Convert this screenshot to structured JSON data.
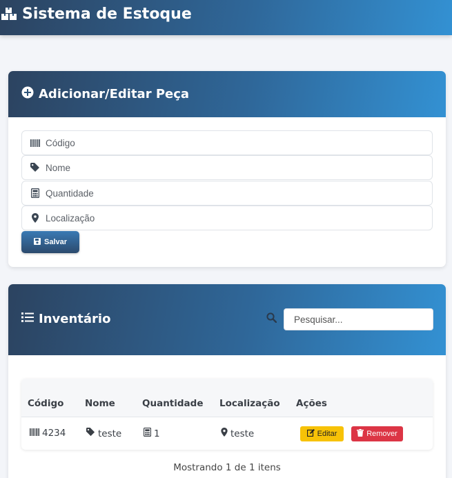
{
  "app": {
    "title": "Sistema de Estoque",
    "icon": "boxes-icon"
  },
  "form": {
    "title": "Adicionar/Editar Peça",
    "icon": "plus-circle-icon",
    "fields": {
      "codigo": {
        "placeholder": "Código",
        "value": "",
        "icon": "barcode-icon"
      },
      "nome": {
        "placeholder": "Nome",
        "value": "",
        "icon": "tag-icon"
      },
      "quantidade": {
        "placeholder": "Quantidade",
        "value": "",
        "icon": "calculator-icon"
      },
      "localizacao": {
        "placeholder": "Localização",
        "value": "",
        "icon": "map-marker-icon"
      }
    },
    "save_label": "Salvar",
    "save_icon": "save-icon"
  },
  "inventory": {
    "title": "Inventário",
    "icon": "list-icon",
    "search": {
      "placeholder": "Pesquisar...",
      "value": "",
      "icon": "search-icon"
    },
    "columns": [
      "Código",
      "Nome",
      "Quantidade",
      "Localização",
      "Ações"
    ],
    "rows": [
      {
        "codigo": "4234",
        "nome": "teste",
        "quantidade": "1",
        "localizacao": "teste",
        "edit_label": "Editar",
        "remove_label": "Remover"
      }
    ],
    "count_text": "Mostrando 1 de 1 itens"
  },
  "colors": {
    "header_start": "#2c4360",
    "header_end": "#3391d3",
    "edit": "#f7c207",
    "remove": "#dc3545"
  }
}
